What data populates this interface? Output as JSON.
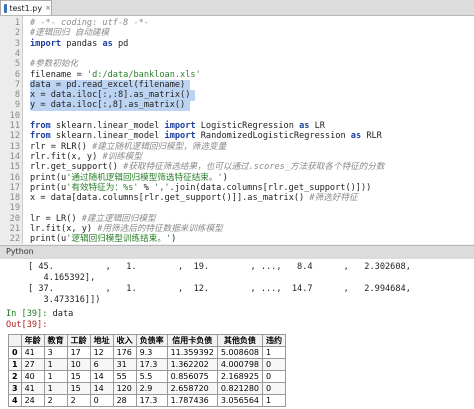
{
  "editor": {
    "tab_label": "test1.py",
    "tab_close": "×",
    "lines": [
      {
        "num": "1",
        "text": "# -*- coding: utf-8 -*-",
        "kind": "comment"
      },
      {
        "num": "2",
        "text": "#逻辑回归 自动建模",
        "kind": "comment"
      },
      {
        "num": "3",
        "text": "import pandas as pd",
        "kind": "import"
      },
      {
        "num": "4",
        "text": "",
        "kind": "plain"
      },
      {
        "num": "5",
        "text": "#参数初始化",
        "kind": "comment"
      },
      {
        "num": "6",
        "text": "filename = 'd:/data/bankloan.xls'",
        "kind": "plain"
      },
      {
        "num": "7",
        "text": "data = pd.read_excel(filename)",
        "kind": "selected"
      },
      {
        "num": "8",
        "text": "x = data.iloc[:,:8].as_matrix()",
        "kind": "selected"
      },
      {
        "num": "9",
        "text": "y = data.iloc[:,8].as_matrix()",
        "kind": "selected"
      },
      {
        "num": "10",
        "text": "",
        "kind": "plain"
      },
      {
        "num": "11",
        "text": "from sklearn.linear_model import LogisticRegression as LR",
        "kind": "import"
      },
      {
        "num": "12",
        "text": "from sklearn.linear_model import RandomizedLogisticRegression as RLR",
        "kind": "import"
      },
      {
        "num": "13",
        "text": "rlr = RLR() #建立随机逻辑回归模型，筛选变量",
        "kind": "plain"
      },
      {
        "num": "14",
        "text": "rlr.fit(x, y) #训练模型",
        "kind": "plain"
      },
      {
        "num": "15",
        "text": "rlr.get_support() #获取特征筛选结果，也可以通过.scores_方法获取各个特征的分数",
        "kind": "plain"
      },
      {
        "num": "16",
        "text": "print(u'通过随机逻辑回归模型筛选特征结束。')",
        "kind": "plain"
      },
      {
        "num": "17",
        "text": "print(u'有效特征为：%s' % ','.join(data.columns[rlr.get_support()]))",
        "kind": "plain"
      },
      {
        "num": "18",
        "text": "x = data[data.columns[rlr.get_support()]].as_matrix() #筛选好特征",
        "kind": "plain"
      },
      {
        "num": "19",
        "text": "",
        "kind": "plain"
      },
      {
        "num": "20",
        "text": "lr = LR() #建立逻辑回归模型",
        "kind": "plain"
      },
      {
        "num": "21",
        "text": "lr.fit(x, y) #用筛选后的特征数据来训练模型",
        "kind": "plain"
      },
      {
        "num": "22",
        "text": "print(u'逻辑回归模型训练结束。')",
        "kind": "plain"
      }
    ]
  },
  "console": {
    "title": "Python",
    "lines": [
      "[ 45.          ,   1.        ,  19.        , ...,   8.4      ,   2.302608,",
      "   4.165392],",
      "[ 37.          ,   1.        ,  12.        , ...,  14.7      ,   2.994684,",
      "   3.473316]])"
    ],
    "in_prompt": "In [39]:",
    "in_command": "data",
    "out_prompt": "Out[39]:",
    "table": {
      "headers": [
        "",
        "年龄",
        "教育",
        "工龄",
        "地址",
        "收入",
        "负债率",
        "信用卡负债",
        "其他负债",
        "违约"
      ],
      "rows": [
        [
          "0",
          "41",
          "3",
          "17",
          "12",
          "176",
          "9.3",
          "11.359392",
          "5.008608",
          "1"
        ],
        [
          "1",
          "27",
          "1",
          "10",
          "6",
          "31",
          "17.3",
          "1.362202",
          "4.000798",
          "0"
        ],
        [
          "2",
          "40",
          "1",
          "15",
          "14",
          "55",
          "5.5",
          "0.856075",
          "2.168925",
          "0"
        ],
        [
          "3",
          "41",
          "1",
          "15",
          "14",
          "120",
          "2.9",
          "2.658720",
          "0.821280",
          "0"
        ],
        [
          "4",
          "24",
          "2",
          "2",
          "0",
          "28",
          "17.3",
          "1.787436",
          "3.056564",
          "1"
        ]
      ]
    }
  }
}
